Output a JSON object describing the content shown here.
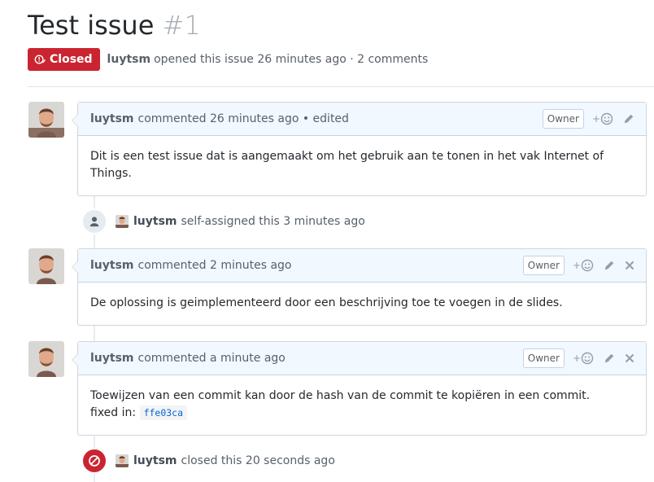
{
  "issue": {
    "title": "Test issue",
    "number": "#1",
    "state": "Closed",
    "author": "luytsm",
    "opened_text": "opened this issue 26 minutes ago · 2 comments"
  },
  "comments": [
    {
      "author": "luytsm",
      "meta": "commented 26 minutes ago • edited",
      "badge": "Owner",
      "body": "Dit is een test issue dat is aangemaakt om het gebruik aan te tonen in het vak Internet of Things."
    },
    {
      "author": "luytsm",
      "meta": "commented 2 minutes ago",
      "badge": "Owner",
      "body": "De oplossing is geimplementeerd door een beschrijving toe te voegen in de slides."
    },
    {
      "author": "luytsm",
      "meta": "commented a minute ago",
      "badge": "Owner",
      "body": "Toewijzen van een commit kan door de hash van de commit te kopiëren in een commit.",
      "fixed_label": "fixed in:",
      "commit": "ffe03ca"
    }
  ],
  "events": [
    {
      "author": "luytsm",
      "text": "self-assigned this 3 minutes ago",
      "icon": "person-icon"
    },
    {
      "author": "luytsm",
      "text": "closed this 20 seconds ago",
      "icon": "circle-slash-icon"
    }
  ],
  "reaction_plus": "+",
  "colors": {
    "closed": "#cb2431",
    "header_bg": "#f1f8ff",
    "link": "#0366d6"
  }
}
